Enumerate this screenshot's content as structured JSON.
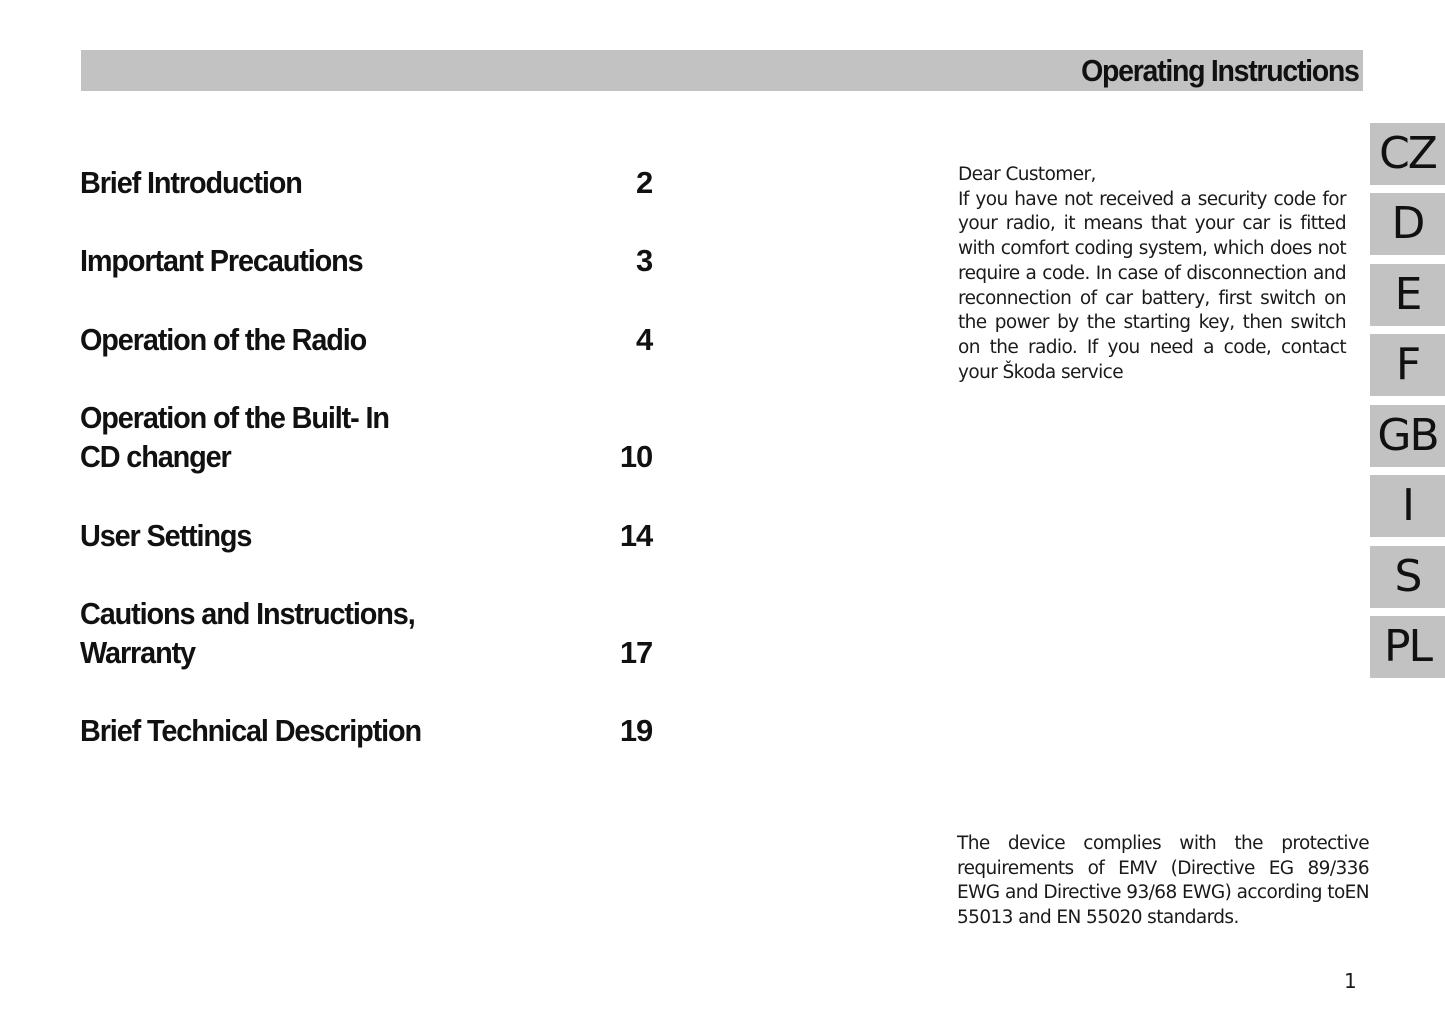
{
  "header": {
    "title": "Operating Instructions"
  },
  "toc": [
    {
      "title": "Brief Introduction",
      "page": "2"
    },
    {
      "title": "Important Precautions",
      "page": "3"
    },
    {
      "title": "Operation of the Radio",
      "page": "4"
    },
    {
      "title": "Operation of the Built- In\nCD changer",
      "page": "10"
    },
    {
      "title": "User Settings",
      "page": "14"
    },
    {
      "title": "Cautions and Instructions,\nWarranty",
      "page": "17"
    },
    {
      "title": "Brief Technical Description",
      "page": "19"
    }
  ],
  "intro": {
    "greeting": "Dear Customer,",
    "body": "If you have not received a security code for your radio, it means that your car is fitted with comfort coding system, which does not require a code. In case of disconnection and reconnection of car battery, first switch on the power by the starting key, then switch on the radio. If you need a code, contact your Škoda service"
  },
  "compliance": "The device complies with the protective requirements of EMV (Directive EG 89/336 EWG and Directive 93/68 EWG) according toEN 55013 and EN 55020 standards.",
  "languages": [
    "CZ",
    "D",
    "E",
    "F",
    "GB",
    "I",
    "S",
    "PL"
  ],
  "page_number": "1",
  "colors": {
    "tab_background": "#c2c2c2",
    "header_background": "#c2c2c2",
    "text": "#111111"
  }
}
